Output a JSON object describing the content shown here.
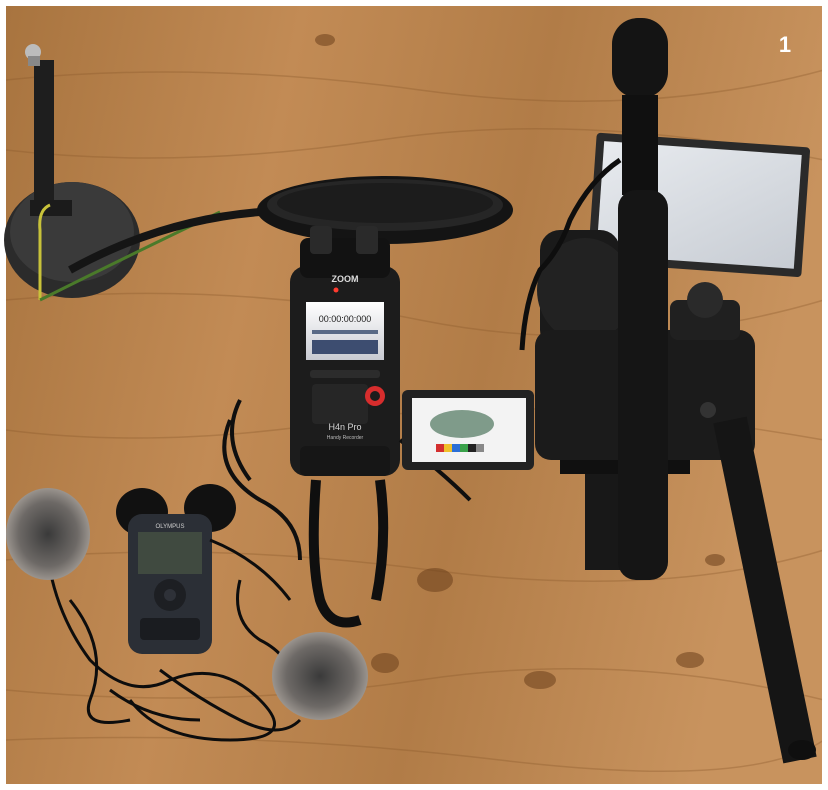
{
  "figure": {
    "number": "1"
  },
  "devices": {
    "recorder_brand": "ZOOM",
    "recorder_model": "H4n Pro",
    "recorder_subtitle": "Handy Recorder",
    "recorder_display_time": "00:00:00:000",
    "small_recorder_brand": "OLYMPUS"
  },
  "colors": {
    "table_wood": "#b8834e",
    "white_border": "#ffffff"
  }
}
